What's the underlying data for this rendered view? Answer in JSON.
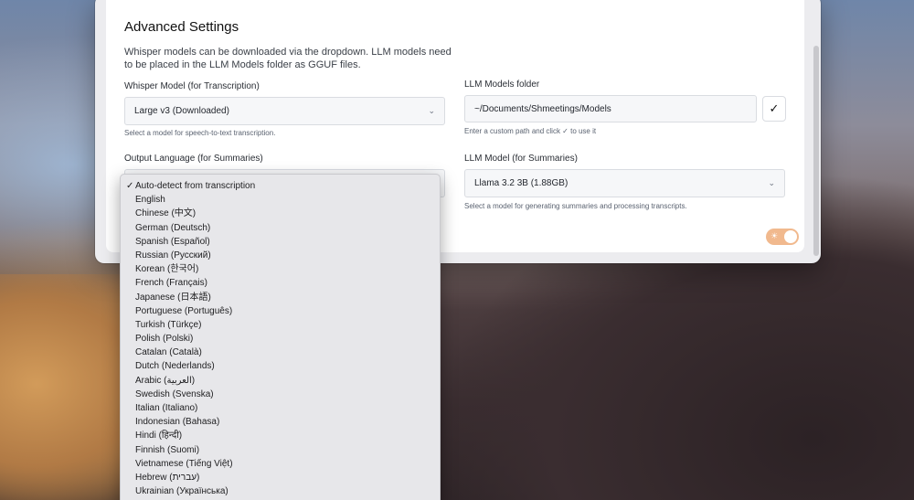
{
  "section": {
    "title": "Advanced Settings",
    "description": "Whisper models can be downloaded via the dropdown. LLM models need to be placed in the LLM Models folder as GGUF files."
  },
  "whisper": {
    "label": "Whisper Model (for Transcription)",
    "selected": "Large v3 (Downloaded)",
    "help": "Select a model for speech-to-text transcription."
  },
  "llm_folder": {
    "label": "LLM Models folder",
    "value": "~/Documents/Shmeetings/Models",
    "help": "Enter a custom path and click ✓ to use it",
    "confirm_icon": "checkmark-icon"
  },
  "output_language": {
    "label": "Output Language (for Summaries)",
    "selected": "Auto-detect from transcription",
    "options": [
      "Auto-detect from transcription",
      "English",
      "Chinese (中文)",
      "German (Deutsch)",
      "Spanish (Español)",
      "Russian (Русский)",
      "Korean (한국어)",
      "French (Français)",
      "Japanese (日本語)",
      "Portuguese (Português)",
      "Turkish (Türkçe)",
      "Polish (Polski)",
      "Catalan (Català)",
      "Dutch (Nederlands)",
      "Arabic (العربية)",
      "Swedish (Svenska)",
      "Italian (Italiano)",
      "Indonesian (Bahasa)",
      "Hindi (हिन्दी)",
      "Finnish (Suomi)",
      "Vietnamese (Tiếng Việt)",
      "Hebrew (עברית)",
      "Ukrainian (Українська)"
    ]
  },
  "llm_model": {
    "label": "LLM Model (for Summaries)",
    "selected": "Llama 3.2 3B (1.88GB)",
    "help": "Select a model for generating summaries and processing transcripts."
  },
  "theme_toggle": {
    "state": "on",
    "icon": "sun-icon"
  },
  "colors": {
    "toggle_accent": "#f1b98e",
    "panel": "#ffffff"
  }
}
